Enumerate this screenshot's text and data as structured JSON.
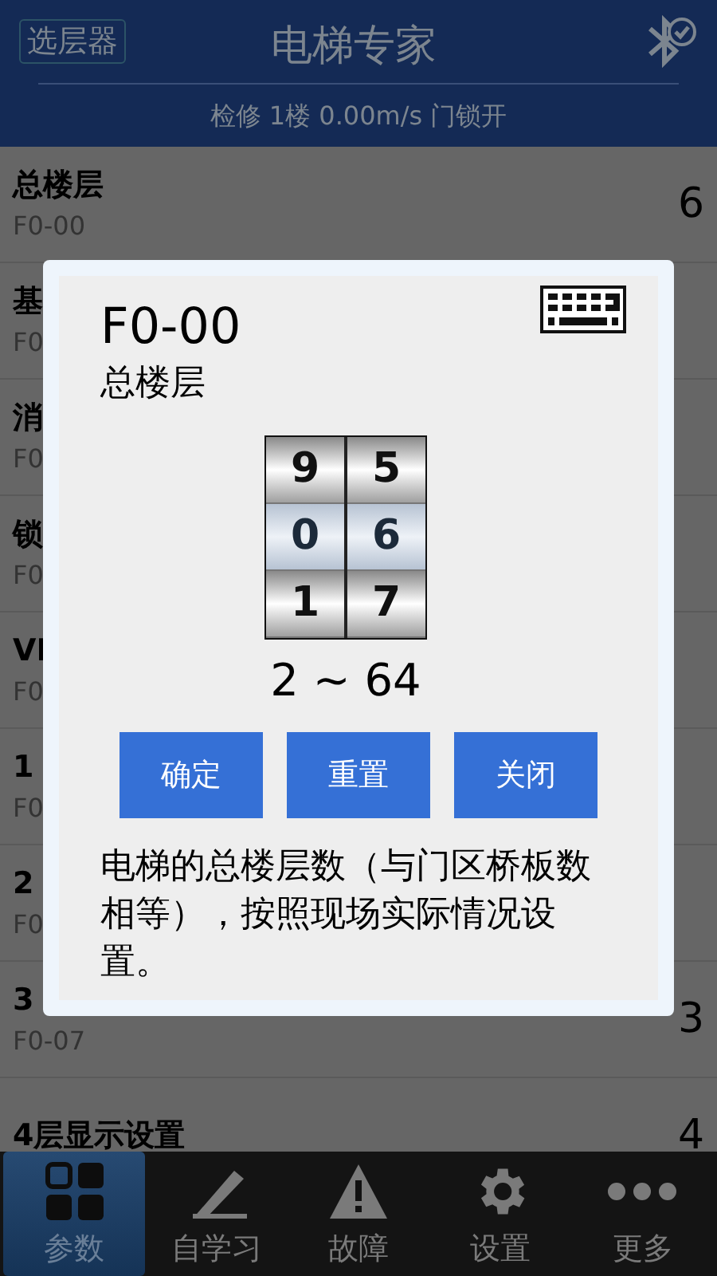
{
  "header": {
    "selector_button": "选层器",
    "title": "电梯专家",
    "status": "检修 1楼 0.00m/s 门锁开"
  },
  "list": [
    {
      "title": "总楼层",
      "code": "F0-00",
      "value": "6"
    },
    {
      "title": "基",
      "code": "F0"
    },
    {
      "title": "消",
      "code": "F0"
    },
    {
      "title": "锁",
      "code": "F0"
    },
    {
      "title": "VI",
      "code": "F0"
    },
    {
      "title": "1",
      "code": "F0"
    },
    {
      "title": "2",
      "code": "F0"
    },
    {
      "title": "3",
      "code": "F0-07",
      "value": "3"
    },
    {
      "title": "4层显示设置",
      "value": "4"
    }
  ],
  "dialog": {
    "code": "F0-00",
    "name": "总楼层",
    "picker": [
      [
        {
          "digit": "9",
          "selected": false
        },
        {
          "digit": "0",
          "selected": true
        },
        {
          "digit": "1",
          "selected": false
        }
      ],
      [
        {
          "digit": "5",
          "selected": false
        },
        {
          "digit": "6",
          "selected": true
        },
        {
          "digit": "7",
          "selected": false
        }
      ]
    ],
    "range": "2 ~ 64",
    "buttons": [
      "确定",
      "重置",
      "关闭"
    ],
    "description": "电梯的总楼层数（与门区桥板数相等），按照现场实际情况设置。"
  },
  "tabs": [
    {
      "label": "参数",
      "kind": "grid",
      "selected": true
    },
    {
      "label": "自学习",
      "kind": "pencil",
      "selected": false
    },
    {
      "label": "故障",
      "kind": "warning",
      "selected": false
    },
    {
      "label": "设置",
      "kind": "gear",
      "selected": false
    },
    {
      "label": "更多",
      "kind": "dots",
      "selected": false
    }
  ]
}
